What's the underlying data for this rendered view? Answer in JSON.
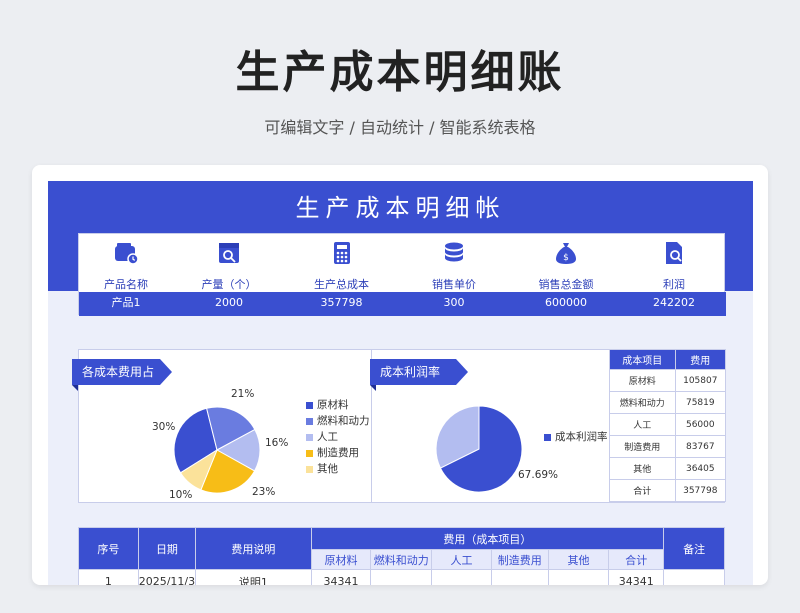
{
  "page": {
    "title": "生产成本明细账",
    "subtitle": "可编辑文字 / 自动统计 / 智能系统表格"
  },
  "sheet": {
    "banner": "生产成本明细帐",
    "summary": [
      {
        "label": "产品名称",
        "value": "产品1",
        "icon": "wallet-icon"
      },
      {
        "label": "产量（个）",
        "value": "2000",
        "icon": "box-search-icon"
      },
      {
        "label": "生产总成本",
        "value": "357798",
        "icon": "calculator-icon"
      },
      {
        "label": "销售单价",
        "value": "300",
        "icon": "coin-stack-icon"
      },
      {
        "label": "销售总金额",
        "value": "600000",
        "icon": "money-bag-icon"
      },
      {
        "label": "利润",
        "value": "242202",
        "icon": "document-search-icon"
      }
    ],
    "accent_color": "#3a4fd0"
  },
  "pie_chart": {
    "title": "各成本费用占比",
    "chart_data": {
      "type": "pie",
      "categories": [
        "原材料",
        "燃料和动力",
        "人工",
        "制造费用",
        "其他"
      ],
      "values": [
        30,
        21,
        16,
        23,
        10
      ],
      "labels": [
        "30%",
        "21%",
        "16%",
        "23%",
        "10%"
      ],
      "colors": [
        "#3a4fd0",
        "#6a7ce0",
        "#b3bdf0",
        "#f7bd17",
        "#fbe29a"
      ]
    }
  },
  "ratio_chart": {
    "title": "成本利润率",
    "chart_data": {
      "type": "pie",
      "categories": [
        "成本利润率"
      ],
      "values": [
        67.69
      ],
      "labels": [
        "67.69%"
      ],
      "colors": [
        "#3a4fd0",
        "#b3bdf0"
      ]
    }
  },
  "cost_table": {
    "headers": [
      "成本项目",
      "费用"
    ],
    "rows": [
      [
        "原材料",
        "105807"
      ],
      [
        "燃料和动力",
        "75819"
      ],
      [
        "人工",
        "56000"
      ],
      [
        "制造费用",
        "83767"
      ],
      [
        "其他",
        "36405"
      ],
      [
        "合计",
        "357798"
      ]
    ]
  },
  "detail_table": {
    "headers": {
      "index": "序号",
      "date": "日期",
      "desc": "费用说明",
      "group": "费用（成本项目）",
      "note": "备注"
    },
    "sub_headers": [
      "原材料",
      "燃料和动力",
      "人工",
      "制造费用",
      "其他",
      "合计"
    ],
    "rows": [
      [
        "1",
        "2025/11/3",
        "说明1",
        "34341",
        "",
        "",
        "",
        "",
        "34341",
        ""
      ]
    ]
  }
}
